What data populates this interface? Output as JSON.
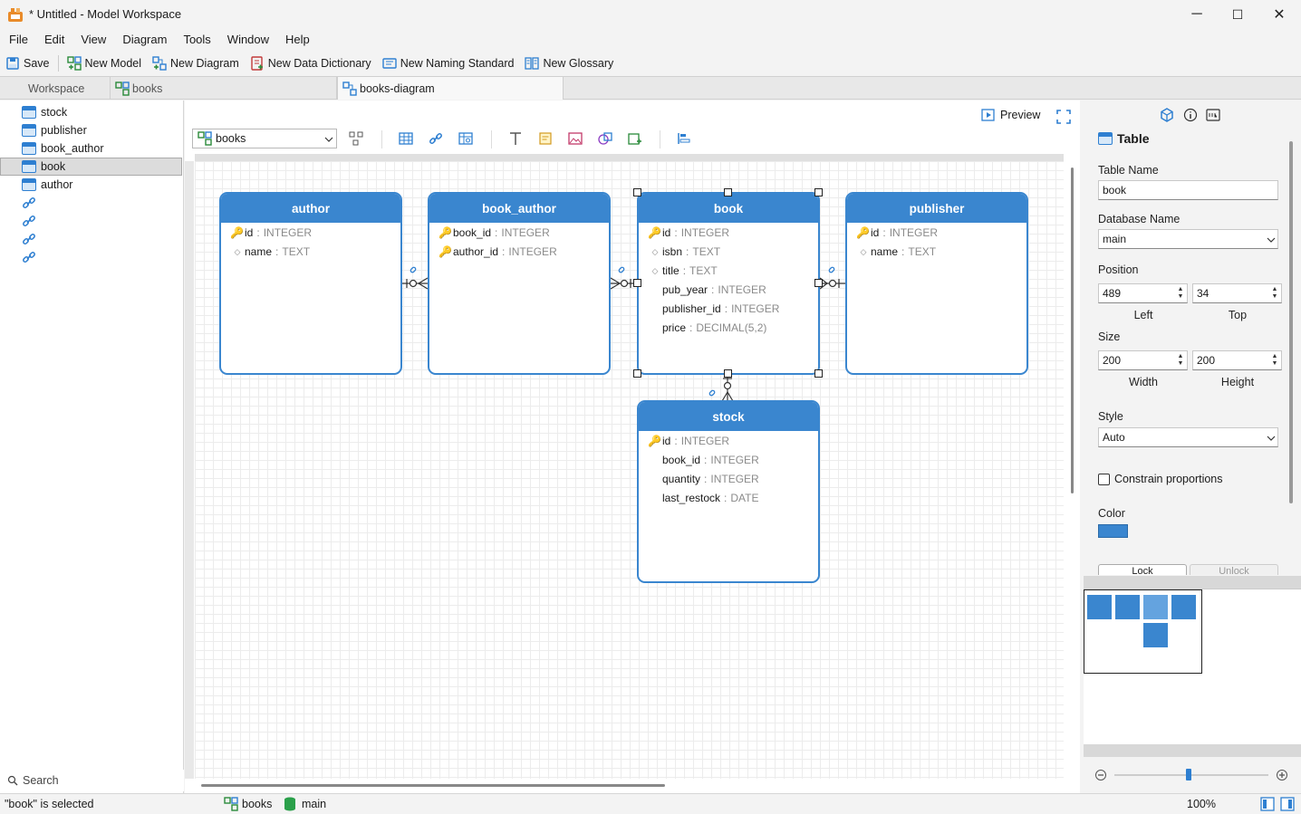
{
  "window": {
    "title": "* Untitled - Model Workspace",
    "minimize": "─",
    "maximize": "☐",
    "close": "✕"
  },
  "menu": [
    "File",
    "Edit",
    "View",
    "Diagram",
    "Tools",
    "Window",
    "Help"
  ],
  "toolbar": {
    "save": "Save",
    "new_model": "New Model",
    "new_diagram": "New Diagram",
    "new_data_dictionary": "New Data Dictionary",
    "new_naming_standard": "New Naming Standard",
    "new_glossary": "New Glossary"
  },
  "tabs": {
    "workspace": "Workspace",
    "books": "books",
    "books_diagram": "books-diagram"
  },
  "tree": {
    "tables": [
      "stock",
      "publisher",
      "book_author",
      "book",
      "author"
    ],
    "selected": "book",
    "relationship_count": 4
  },
  "search_label": "Search",
  "diagram_toolbar": {
    "model_select": "books",
    "preview": "Preview"
  },
  "entities": {
    "author": {
      "name": "author",
      "columns": [
        {
          "key": true,
          "name": "id",
          "type": "INTEGER"
        },
        {
          "key": false,
          "name": "name",
          "type": "TEXT"
        }
      ]
    },
    "book_author": {
      "name": "book_author",
      "columns": [
        {
          "key": true,
          "name": "book_id",
          "type": "INTEGER"
        },
        {
          "key": true,
          "name": "author_id",
          "type": "INTEGER"
        }
      ]
    },
    "book": {
      "name": "book",
      "columns": [
        {
          "key": true,
          "name": "id",
          "type": "INTEGER"
        },
        {
          "key": false,
          "name": "isbn",
          "type": "TEXT"
        },
        {
          "key": false,
          "name": "title",
          "type": "TEXT"
        },
        {
          "key": null,
          "name": "pub_year",
          "type": "INTEGER"
        },
        {
          "key": null,
          "name": "publisher_id",
          "type": "INTEGER"
        },
        {
          "key": null,
          "name": "price",
          "type": "DECIMAL(5,2)"
        }
      ]
    },
    "publisher": {
      "name": "publisher",
      "columns": [
        {
          "key": true,
          "name": "id",
          "type": "INTEGER"
        },
        {
          "key": false,
          "name": "name",
          "type": "TEXT"
        }
      ]
    },
    "stock": {
      "name": "stock",
      "columns": [
        {
          "key": true,
          "name": "id",
          "type": "INTEGER"
        },
        {
          "key": null,
          "name": "book_id",
          "type": "INTEGER"
        },
        {
          "key": null,
          "name": "quantity",
          "type": "INTEGER"
        },
        {
          "key": null,
          "name": "last_restock",
          "type": "DATE"
        }
      ]
    }
  },
  "properties": {
    "section": "Table",
    "table_name_label": "Table Name",
    "table_name": "book",
    "database_name_label": "Database Name",
    "database_name": "main",
    "position_label": "Position",
    "left": "489",
    "top": "34",
    "left_label": "Left",
    "top_label": "Top",
    "size_label": "Size",
    "width": "200",
    "height": "200",
    "width_label": "Width",
    "height_label": "Height",
    "style_label": "Style",
    "style": "Auto",
    "constrain_label": "Constrain proportions",
    "color_label": "Color",
    "color": "#3a86cf",
    "lock": "Lock",
    "unlock": "Unlock"
  },
  "status": {
    "message": "\"book\" is selected",
    "model": "books",
    "database": "main",
    "zoom": "100%",
    "zoom_level": 0.5
  },
  "colors": {
    "accent": "#3a86cf",
    "key": "#e8a317"
  }
}
